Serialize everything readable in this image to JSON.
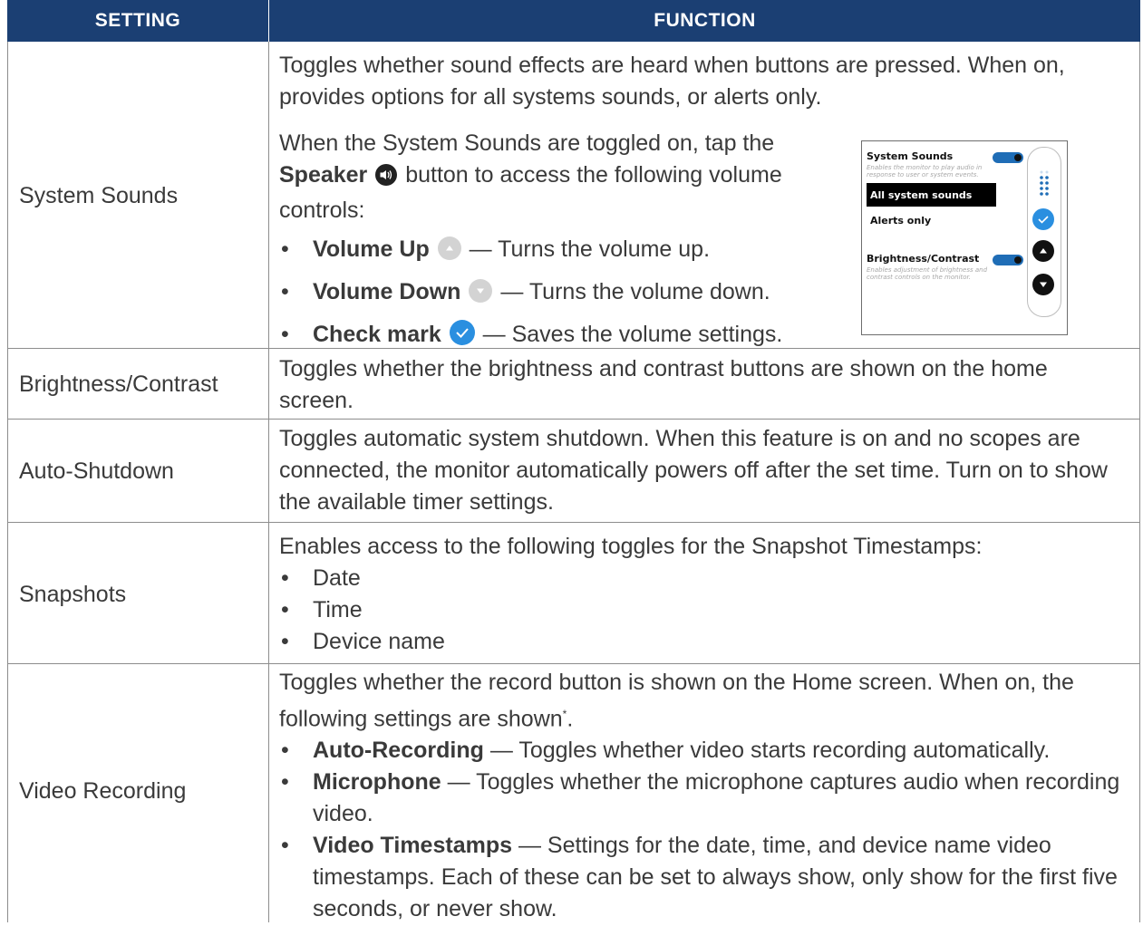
{
  "header": {
    "setting": "SETTING",
    "function": "FUNCTION"
  },
  "rows": {
    "system_sounds": {
      "setting": "System Sounds",
      "desc": "Toggles whether sound effects are heard when buttons are pressed. When on, provides options for all systems sounds, or alerts only.",
      "intro_pre": "When the System Sounds are toggled on, tap the",
      "speaker_label": "Speaker",
      "intro_post": "button to access the following volume controls:",
      "bullets": [
        {
          "label": "Volume Up",
          "text": "— Turns the volume up."
        },
        {
          "label": "Volume Down",
          "text": "— Turns the volume down."
        },
        {
          "label": "Check mark",
          "text": "— Saves the volume settings."
        }
      ],
      "panel": {
        "title1": "System Sounds",
        "sub1": "Enables the monitor to play audio in response to user or system events.",
        "option1": "All system sounds",
        "option2": "Alerts only",
        "title2": "Brightness/Contrast",
        "sub2": "Enables adjustment of brightness and contrast controls on the monitor."
      }
    },
    "brightness": {
      "setting": "Brightness/Contrast",
      "desc": "Toggles whether the brightness and contrast buttons are shown on the home screen."
    },
    "auto_shutdown": {
      "setting": "Auto-Shutdown",
      "desc": "Toggles automatic system shutdown. When this feature is on and no scopes are connected, the monitor automatically powers off after the set time. Turn on to show the available timer settings."
    },
    "snapshots": {
      "setting": "Snapshots",
      "desc": "Enables access to the following toggles for the Snapshot Timestamps:",
      "bullets": [
        "Date",
        "Time",
        "Device name"
      ]
    },
    "video_recording": {
      "setting": "Video Recording",
      "desc": "Toggles whether the record button is shown on the Home screen. When on, the following settings are shown",
      "desc_sup": "*",
      "desc_end": ".",
      "bullets": [
        {
          "label": "Auto-Recording",
          "text": "— Toggles whether video starts recording automatically."
        },
        {
          "label": "Microphone",
          "text": "— Toggles whether the microphone captures audio when recording video."
        },
        {
          "label": "Video Timestamps",
          "text": "— Settings for the date, time, and device name video timestamps. Each of these can be set to always show, only show for the first five seconds, or never show."
        }
      ]
    }
  },
  "colors": {
    "header_bg": "#1b3f73",
    "accent_blue": "#1f6db6",
    "check_blue": "#2a8fe0",
    "icon_gray": "#cfcfcf"
  }
}
